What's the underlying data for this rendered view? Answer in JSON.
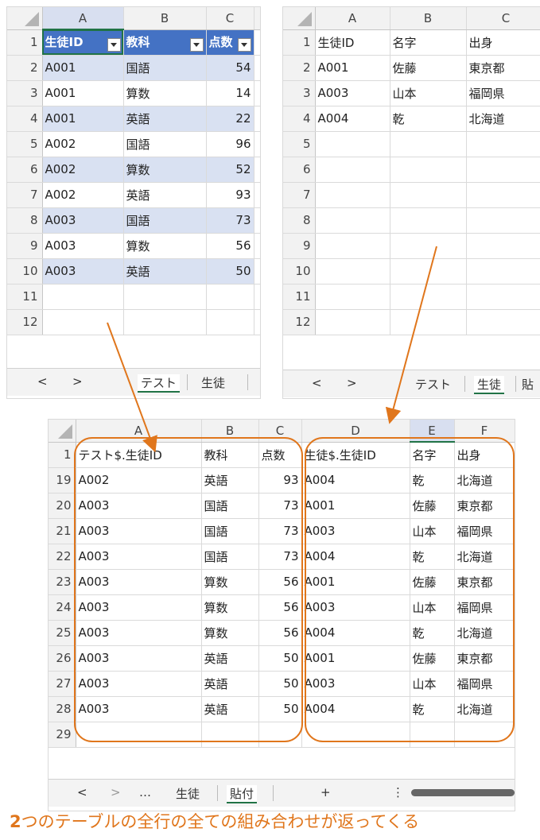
{
  "sheet1": {
    "cols": [
      "A",
      "B",
      "C"
    ],
    "header": [
      "生徒ID",
      "教科",
      "点数"
    ],
    "rows": [
      [
        "2",
        "A001",
        "国語",
        "54"
      ],
      [
        "3",
        "A001",
        "算数",
        "14"
      ],
      [
        "4",
        "A001",
        "英語",
        "22"
      ],
      [
        "5",
        "A002",
        "国語",
        "96"
      ],
      [
        "6",
        "A002",
        "算数",
        "52"
      ],
      [
        "7",
        "A002",
        "英語",
        "93"
      ],
      [
        "8",
        "A003",
        "国語",
        "73"
      ],
      [
        "9",
        "A003",
        "算数",
        "56"
      ],
      [
        "10",
        "A003",
        "英語",
        "50"
      ]
    ],
    "empty_rows": [
      "11",
      "12"
    ],
    "tabs": {
      "prev": "<",
      "next": ">",
      "active": "テスト",
      "other": "生徒"
    }
  },
  "sheet2": {
    "cols": [
      "A",
      "B",
      "C"
    ],
    "header": [
      "生徒ID",
      "名字",
      "出身"
    ],
    "rows": [
      [
        "2",
        "A001",
        "佐藤",
        "東京都"
      ],
      [
        "3",
        "A003",
        "山本",
        "福岡県"
      ],
      [
        "4",
        "A004",
        "乾",
        "北海道"
      ]
    ],
    "empty_rows": [
      "5",
      "6",
      "7",
      "8",
      "9",
      "10",
      "11",
      "12"
    ],
    "tabs": {
      "prev": "<",
      "next": ">",
      "other": "テスト",
      "active": "生徒",
      "partial": "貼"
    }
  },
  "sheet3": {
    "cols": [
      "A",
      "B",
      "C",
      "D",
      "E",
      "F"
    ],
    "header": [
      "テスト$.生徒ID",
      "教科",
      "点数",
      "生徒$.生徒ID",
      "名字",
      "出身"
    ],
    "rows": [
      [
        "19",
        "A002",
        "英語",
        "93",
        "A004",
        "乾",
        "北海道"
      ],
      [
        "20",
        "A003",
        "国語",
        "73",
        "A001",
        "佐藤",
        "東京都"
      ],
      [
        "21",
        "A003",
        "国語",
        "73",
        "A003",
        "山本",
        "福岡県"
      ],
      [
        "22",
        "A003",
        "国語",
        "73",
        "A004",
        "乾",
        "北海道"
      ],
      [
        "23",
        "A003",
        "算数",
        "56",
        "A001",
        "佐藤",
        "東京都"
      ],
      [
        "24",
        "A003",
        "算数",
        "56",
        "A003",
        "山本",
        "福岡県"
      ],
      [
        "25",
        "A003",
        "算数",
        "56",
        "A004",
        "乾",
        "北海道"
      ],
      [
        "26",
        "A003",
        "英語",
        "50",
        "A001",
        "佐藤",
        "東京都"
      ],
      [
        "27",
        "A003",
        "英語",
        "50",
        "A003",
        "山本",
        "福岡県"
      ],
      [
        "28",
        "A003",
        "英語",
        "50",
        "A004",
        "乾",
        "北海道"
      ]
    ],
    "empty_rows": [
      "29"
    ],
    "tabs": {
      "prev": "<",
      "next": ">",
      "more": "…",
      "other": "生徒",
      "active": "貼付",
      "add": "+",
      "menu": "⋮"
    }
  },
  "caption": {
    "lead": "2",
    "text": "つのテーブルの全行の全ての組み合わせが返ってくる"
  },
  "colors": {
    "accent": "#e0761c",
    "table_header": "#4472c4",
    "band": "#d9e1f2",
    "excel_green": "#217346"
  }
}
